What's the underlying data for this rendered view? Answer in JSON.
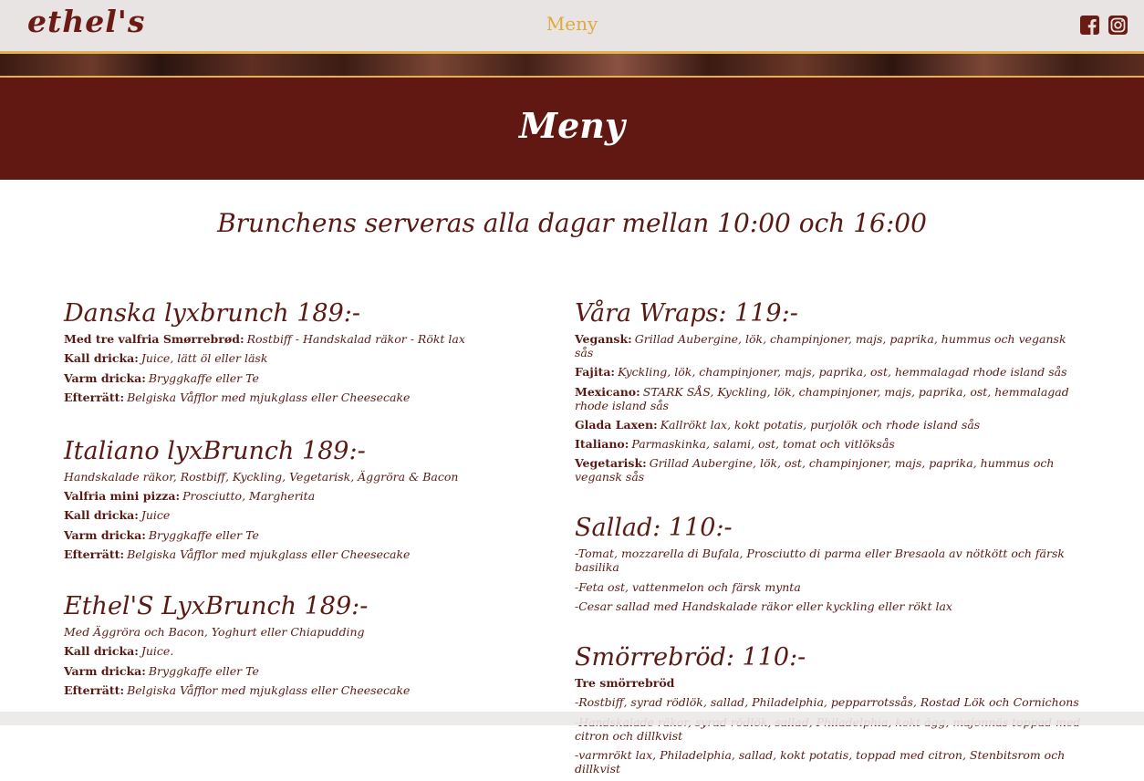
{
  "header": {
    "logo": "ethel's",
    "nav_item": "Meny",
    "social": [
      {
        "icon": "facebook-icon"
      },
      {
        "icon": "instagram-icon"
      }
    ]
  },
  "hero": {
    "title": "Meny"
  },
  "subtitle": "Brunchens serveras alla dagar mellan 10:00 och 16:00",
  "colors": {
    "burgundy": "#611812",
    "gold": "#e3b24c",
    "text": "#5a1a14",
    "nav": "#e0a93a"
  },
  "left_sections": [
    {
      "title": "Danska lyxbrunch 189:-",
      "lines": [
        {
          "label": "Med tre valfria Smørrebrød:",
          "text": "Rostbiff - Handskalad räkor - Rökt lax"
        },
        {
          "label": "Kall dricka:",
          "text": "Juice, lätt öl eller läsk"
        },
        {
          "label": "Varm dricka:",
          "text": "Bryggkaffe eller Te"
        },
        {
          "label": "Efterrätt:",
          "text": "Belgiska Våfflor med mjukglass eller Cheesecake"
        }
      ]
    },
    {
      "title": "Italiano lyxBrunch 189:-",
      "lines": [
        {
          "label": "",
          "text": "Handskalade räkor, Rostbiff, Kyckling, Vegetarisk, Äggröra & Bacon"
        },
        {
          "label": "Valfria mini pizza:",
          "text": "Prosciutto, Margherita"
        },
        {
          "label": "Kall dricka:",
          "text": "Juice"
        },
        {
          "label": "Varm dricka:",
          "text": "Bryggkaffe eller Te"
        },
        {
          "label": "Efterrätt:",
          "text": "Belgiska Våfflor med mjukglass eller Cheesecake"
        }
      ]
    },
    {
      "title": "Ethel'S LyxBrunch 189:-",
      "lines": [
        {
          "label": "",
          "text": "Med Äggröra och Bacon, Yoghurt eller Chiapudding"
        },
        {
          "label": "Kall dricka:",
          "text": "Juice."
        },
        {
          "label": "Varm dricka:",
          "text": "Bryggkaffe eller Te"
        },
        {
          "label": "Efterrätt:",
          "text": "Belgiska Våfflor med mjukglass eller Cheesecake"
        }
      ]
    }
  ],
  "right_sections": [
    {
      "title": "Våra Wraps: 119:-",
      "lines": [
        {
          "label": "Vegansk:",
          "text": "Grillad Aubergine, lök, champinjoner, majs, paprika, hummus och vegansk sås"
        },
        {
          "label": "Fajita:",
          "text": "Kyckling, lök, champinjoner, majs, paprika, ost, hemmalagad rhode island sås"
        },
        {
          "label": "Mexicano:",
          "text": "STARK SÅS, Kyckling, lök, champinjoner, majs, paprika, ost, hemmalagad rhode island sås"
        },
        {
          "label": "Glada Laxen:",
          "text": "Kallrökt lax, kokt potatis, purjolök och rhode island sås"
        },
        {
          "label": "Italiano:",
          "text": "Parmaskinka, salami, ost, tomat och vitlöksås"
        },
        {
          "label": "Vegetarisk:",
          "text": "Grillad Aubergine, lök, ost, champinjoner, majs, paprika, hummus och vegansk sås"
        }
      ]
    },
    {
      "title": "Sallad: 110:-",
      "lines": [
        {
          "label": "",
          "text": "-Tomat, mozzarella di Bufala, Prosciutto di parma eller Bresaola av nötkött och färsk basilika"
        },
        {
          "label": "",
          "text": "-Feta ost, vattenmelon och färsk mynta"
        },
        {
          "label": "",
          "text": "-Cesar sallad med Handskalade räkor eller kyckling eller rökt lax"
        }
      ]
    },
    {
      "title": "Smörrebröd: 110:-",
      "lines": [
        {
          "label": "Tre smörrebröd",
          "text": ""
        },
        {
          "label": "",
          "text": "-Rostbiff, syrad rödlök, sallad, Philadelphia, pepparrotssås, Rostad Lök och Cornichons"
        },
        {
          "label": "",
          "text": "-Handskalade räkor, syrad rödlök, sallad, Philadelphia, kokt ägg, majonnäs toppad med citron och dillkvist"
        },
        {
          "label": "",
          "text": "-varmrökt lax, Philadelphia, sallad, kokt potatis, toppad med citron, Stenbitsrom och dillkvist"
        }
      ]
    }
  ]
}
